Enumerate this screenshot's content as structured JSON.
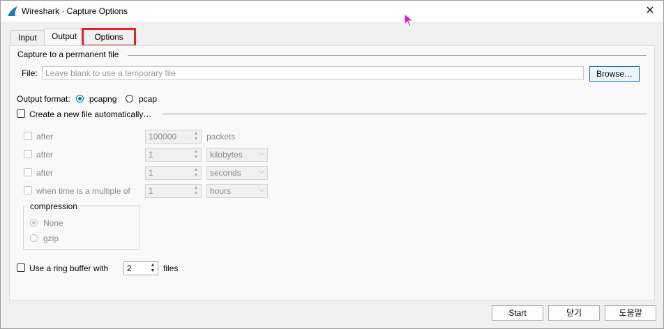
{
  "window": {
    "title": "Wireshark · Capture Options",
    "close_glyph": "✕",
    "app_icon": "wireshark-fin-icon"
  },
  "tabs": [
    {
      "label": "Input"
    },
    {
      "label": "Output"
    },
    {
      "label": "Options",
      "highlighted": true
    }
  ],
  "capture_file": {
    "section_title": "Capture to a permanent file",
    "file_label": "File:",
    "file_placeholder": "Leave blank to use a temporary file",
    "browse_label": "Browse…"
  },
  "output_format": {
    "label": "Output format:",
    "options": [
      "pcapng",
      "pcap"
    ],
    "selected": "pcapng"
  },
  "auto_file": {
    "checkbox_label": "Create a new file automatically…",
    "checked": false,
    "rows": [
      {
        "check_label": "after",
        "value": "100000",
        "unit": "packets",
        "unit_is_dropdown": false
      },
      {
        "check_label": "after",
        "value": "1",
        "unit": "kilobytes",
        "unit_is_dropdown": true
      },
      {
        "check_label": "after",
        "value": "1",
        "unit": "seconds",
        "unit_is_dropdown": true
      },
      {
        "check_label": "when time is a multiple of",
        "value": "1",
        "unit": "hours",
        "unit_is_dropdown": true
      }
    ],
    "compression": {
      "title": "compression",
      "options": [
        "None",
        "gzip"
      ],
      "selected": "None"
    }
  },
  "ring_buffer": {
    "label": "Use a ring buffer with",
    "value": "2",
    "suffix": "files",
    "checked": false
  },
  "footer": {
    "start_label": "Start",
    "close_label": "닫기",
    "help_label": "도움말"
  },
  "colors": {
    "highlight_border": "#e8202a",
    "radio_accent": "#0067c0",
    "browse_border": "#0a64c8"
  }
}
